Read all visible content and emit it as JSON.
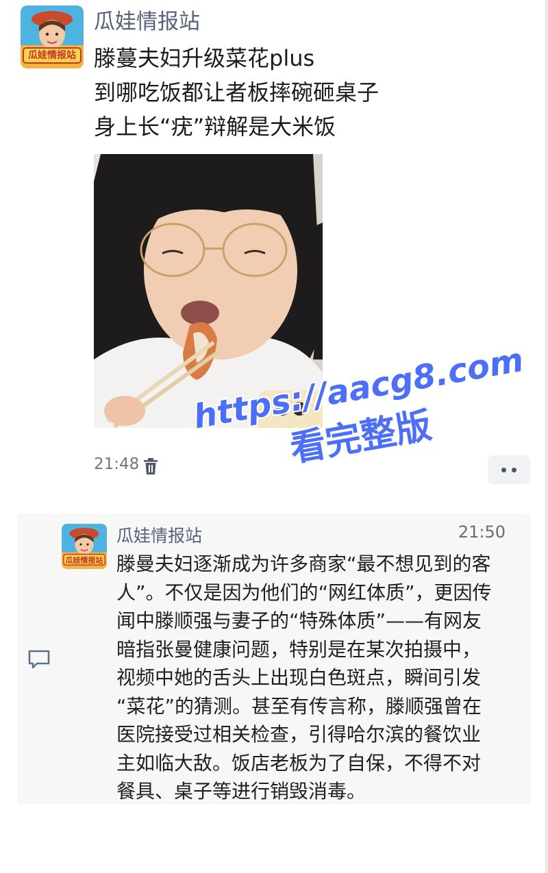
{
  "post": {
    "username": "瓜娃情报站",
    "avatar_badge_text": "瓜娃情报站",
    "lines": [
      "滕蔓夫妇升级菜花plus",
      "到哪吃饭都让者板摔碗砸桌子",
      "身上长“疣”辩解是大米饭"
    ],
    "time": "21:48",
    "delete_icon": "trash-icon",
    "more_icon": "more-dots-icon"
  },
  "watermark": {
    "url": "https://aacg8.com",
    "subtitle": "看完整版",
    "color": "#4d6ff7"
  },
  "comment": {
    "icon": "comment-bubble-icon",
    "username": "瓜娃情报站",
    "avatar_badge_text": "瓜娃情报站",
    "time": "21:50",
    "lines": [
      "滕曼夫妇逐渐成为许多商家“最不想见到的客",
      "人”。不仅是因为他们的“网红体质”，更因传",
      "闻中滕顺强与妻子的“特殊体质”——有网友",
      "暗指张曼健康问题，特别是在某次拍摄中，",
      "视频中她的舌头上出现白色斑点，瞬间引发",
      "“菜花”的猜测。甚至有传言称，滕顺强曾在",
      "医院接受过相关检查，引得哈尔滨的餐饮业",
      "主如临大敌。饭店老板为了自保，不得不对",
      "餐具、桌子等进行销毁消毒。"
    ]
  },
  "colors": {
    "username": "#56627a",
    "body_text": "#1b1b1b",
    "card_bg": "#f7f7f8",
    "meta_text": "#757575"
  }
}
